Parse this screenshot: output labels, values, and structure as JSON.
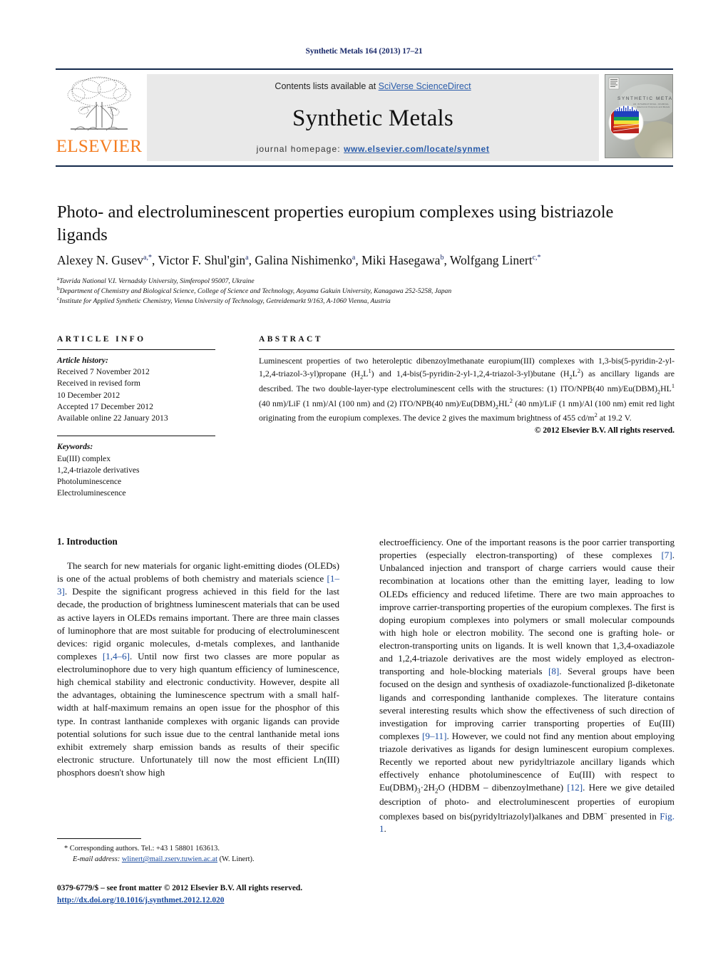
{
  "running_head": "Synthetic Metals 164 (2013) 17–21",
  "masthead": {
    "publisher_word": "ELSEVIER",
    "contents_prefix": "Contents lists available at ",
    "contents_link": "SciVerse ScienceDirect",
    "journal_name": "Synthetic Metals",
    "homepage_label": "journal homepage:",
    "homepage_url": "www.elsevier.com/locate/synmet",
    "cover_caption": "SYNTHETIC METALS"
  },
  "article": {
    "title": "Photo- and electroluminescent properties europium complexes using bistriazole ligands",
    "authors_html": "Alexey N. Gusev<sup>a,*</sup>, Victor F. Shul'gin<sup>a</sup>, Galina Nishimenko<sup>a</sup>, Miki Hasegawa<sup>b</sup>, Wolfgang Linert<sup>c,*</sup>",
    "affiliations": [
      "Tavrida National V.I. Vernadsky University, Simferopol 95007, Ukraine",
      "Department of Chemistry and Biological Science, College of Science and Technology, Aoyama Gakuin University, Kanagawa 252-5258, Japan",
      "Institute for Applied Synthetic Chemistry, Vienna University of Technology, Getreidemarkt 9/163, A-1060 Vienna, Austria"
    ],
    "affiliation_marks": [
      "a",
      "b",
      "c"
    ]
  },
  "article_info": {
    "heading": "ARTICLE INFO",
    "history_title": "Article history:",
    "history": [
      "Received 7 November 2012",
      "Received in revised form",
      "10 December 2012",
      "Accepted 17 December 2012",
      "Available online 22 January 2013"
    ],
    "keywords_title": "Keywords:",
    "keywords": [
      "Eu(III) complex",
      "1,2,4-triazole derivatives",
      "Photoluminescence",
      "Electroluminescence"
    ]
  },
  "abstract": {
    "heading": "ABSTRACT",
    "body_html": "Luminescent properties of two heteroleptic dibenzoylmethanate europium(III) complexes with 1,3-bis(5-pyridin-2-yl-1,2,4-triazol-3-yl)propane (H<sub>2</sub>L<sup>1</sup>) and 1,4-bis(5-pyridin-2-yl-1,2,4-triazol-3-yl)butane (H<sub>2</sub>L<sup>2</sup>) as ancillary ligands are described. The two double-layer-type electroluminescent cells with the structures: (1) ITO/NPB(40&nbsp;nm)/Eu(DBM)<sub>2</sub>HL<sup>1</sup> (40&nbsp;nm)/LiF (1&nbsp;nm)/Al (100&nbsp;nm) and (2) ITO/NPB(40&nbsp;nm)/Eu(DBM)<sub>2</sub>HL<sup>2</sup> (40&nbsp;nm)/LiF (1&nbsp;nm)/Al (100&nbsp;nm) emit red light originating from the europium complexes. The device 2 gives the maximum brightness of 455&nbsp;cd/m<sup>2</sup> at 19.2&nbsp;V.",
    "copyright": "© 2012 Elsevier B.V. All rights reserved."
  },
  "introduction": {
    "section_number_title": "1. Introduction",
    "left_paragraph_html": "The search for new materials for organic light-emitting diodes (OLEDs) is one of the actual problems of both chemistry and materials science <span class=\"ref\">[1–3]</span>. Despite the significant progress achieved in this field for the last decade, the production of brightness luminescent materials that can be used as active layers in OLEDs remains important. There are three main classes of luminophore that are most suitable for producing of electroluminescent devices: rigid organic molecules, d-metals complexes, and lanthanide complexes <span class=\"ref\">[1,4–6]</span>. Until now first two classes are more popular as electroluminophore due to very high quantum efficiency of luminescence, high chemical stability and electronic conductivity. However, despite all the advantages, obtaining the luminescence spectrum with a small half-width at half-maximum remains an open issue for the phosphor of this type. In contrast lanthanide complexes with organic ligands can provide potential solutions for such issue due to the central lanthanide metal ions exhibit extremely sharp emission bands as results of their specific electronic structure. Unfortunately till now the most efficient Ln(III) phosphors doesn't show high",
    "right_paragraph_html": "electroefficiency. One of the important reasons is the poor carrier transporting properties (especially electron-transporting) of these complexes <span class=\"ref\">[7]</span>. Unbalanced injection and transport of charge carriers would cause their recombination at locations other than the emitting layer, leading to low OLEDs efficiency and reduced lifetime. There are two main approaches to improve carrier-transporting properties of the europium complexes. The first is doping europium complexes into polymers or small molecular compounds with high hole or electron mobility. The second one is grafting hole- or electron-transporting units on ligands. It is well known that 1,3,4-oxadiazole and 1,2,4-triazole derivatives are the most widely employed as electron-transporting and hole-blocking materials <span class=\"ref\">[8]</span>. Several groups have been focused on the design and synthesis of oxadiazole-functionalized β-diketonate ligands and corresponding lanthanide complexes. The literature contains several interesting results which show the effectiveness of such direction of investigation for improving carrier transporting properties of Eu(III) complexes <span class=\"ref\">[9–11]</span>. However, we could not find any mention about employing triazole derivatives as ligands for design luminescent europium complexes. Recently we reported about new pyridyltriazole ancillary ligands which effectively enhance photoluminescence of Eu(III) with respect to Eu(DBM)<sub>3</sub>·2H<sub>2</sub>O (HDBM – dibenzoylmethane) <span class=\"ref\">[12]</span>. Here we give detailed description of photo- and electroluminescent properties of europium complexes based on bis(pyridyltriazolyl)alkanes and DBM<sup>−</sup> presented in <span class=\"ref\">Fig. 1</span>."
  },
  "footnotes": {
    "corresponding_html": "* Corresponding authors. Tel.: +43 1 58801 163613.",
    "email_label": "E-mail address:",
    "email_link": "wlinert@mail.zserv.tuwien.ac.at",
    "email_suffix": "(W. Linert).",
    "front_matter": "0379-6779/$ – see front matter © 2012 Elsevier B.V. All rights reserved.",
    "doi": "http://dx.doi.org/10.1016/j.synthmet.2012.12.020"
  },
  "colors": {
    "running_head": "#1b2b6b",
    "link_blue": "#1b4ca0",
    "elsevier_orange": "#F47C20",
    "masthead_rule": "#13294b",
    "panel_gray": "#e9e9e9"
  }
}
